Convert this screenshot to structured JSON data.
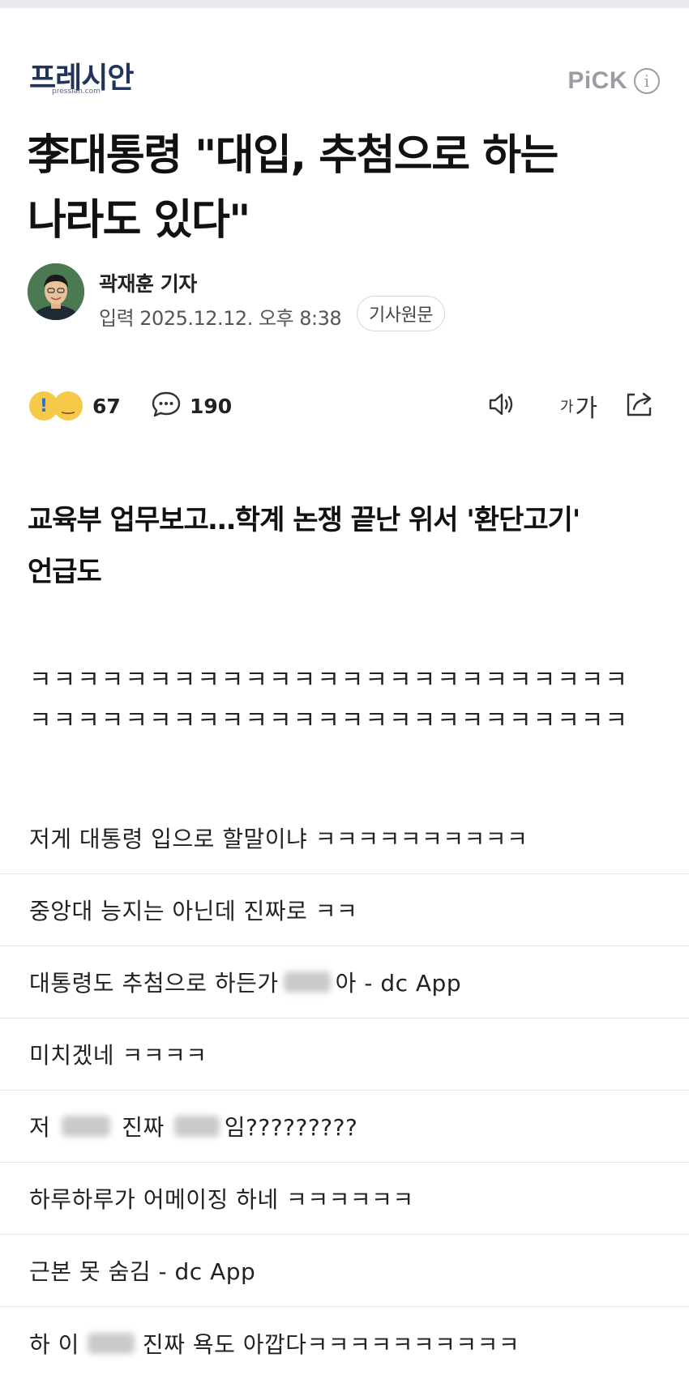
{
  "publisher": {
    "logo_text": "프레시안",
    "logo_sub": "pressian.com",
    "pick_label": "PiCK",
    "info_icon": "info-icon"
  },
  "article": {
    "headline_line1": "李대통령 \"대입, 추첨으로 하는",
    "headline_line2": "나라도 있다\"",
    "author": "곽재훈 기자",
    "date": "입력 2025.12.12. 오후 8:38",
    "original_button": "기사원문",
    "reaction_count": "67",
    "comment_count": "190",
    "font_tool_small": "가",
    "font_tool_large": "가",
    "subhead_line1": "교육부 업무보고…학계 논쟁 끝난 위서 '환단고기'",
    "subhead_line2": "언급도"
  },
  "laughs": [
    "ㅋㅋㅋㅋㅋㅋㅋㅋㅋㅋㅋㅋㅋㅋㅋㅋㅋㅋㅋㅋㅋㅋㅋㅋㅋ",
    "ㅋㅋㅋㅋㅋㅋㅋㅋㅋㅋㅋㅋㅋㅋㅋㅋㅋㅋㅋㅋㅋㅋㅋㅋㅋ"
  ],
  "comments": {
    "c1": "저게 대통령 입으로 할말이냐 ㅋㅋㅋㅋㅋㅋㅋㅋㅋㅋ",
    "c2": "중앙대 능지는 아닌데 진짜로 ㅋㅋ",
    "c3_a": "대통령도 추첨으로 하든가",
    "c3_b": "아 - dc App",
    "c4": "미치겠네 ㅋㅋㅋㅋ",
    "c5_a": "저",
    "c5_b": "진짜",
    "c5_c": "임?????????",
    "c6": "하루하루가 어메이징 하네 ㅋㅋㅋㅋㅋㅋ",
    "c7": "근본 못 숨김 - dc App",
    "c8_a": "하 이",
    "c8_b": "진짜 욕도 아깝다ㅋㅋㅋㅋㅋㅋㅋㅋㅋㅋ"
  },
  "colors": {
    "logo": "#22335c",
    "muted": "#9a9da3",
    "divider": "#e4e5e8"
  }
}
